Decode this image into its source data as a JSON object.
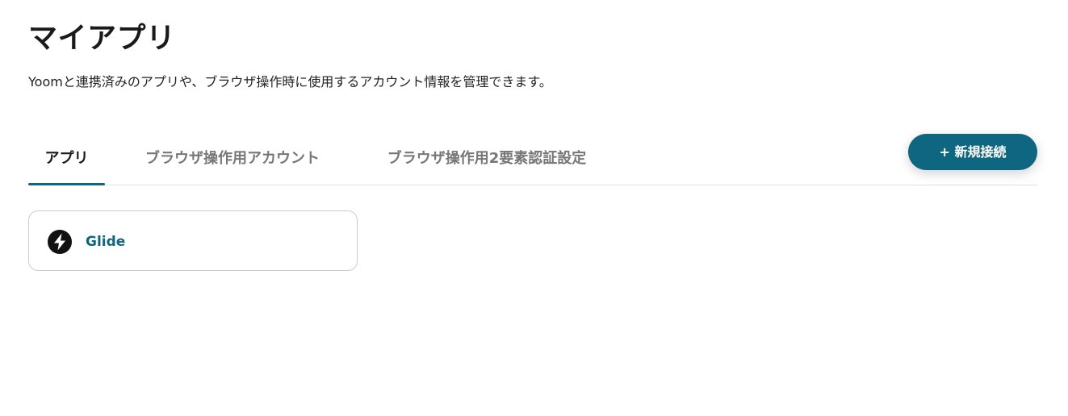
{
  "header": {
    "title": "マイアプリ",
    "description": "Yoomと連携済みのアプリや、ブラウザ操作時に使用するアカウント情報を管理できます。"
  },
  "tabs": [
    {
      "label": "アプリ",
      "active": true
    },
    {
      "label": "ブラウザ操作用アカウント",
      "active": false
    },
    {
      "label": "ブラウザ操作用2要素認証設定",
      "active": false
    }
  ],
  "actions": {
    "new_connection_label": "+ 新規接続"
  },
  "apps": [
    {
      "name": "Glide",
      "icon": "glide-logo-icon"
    }
  ],
  "colors": {
    "accent": "#0f6680",
    "tab_inactive": "#777777",
    "border": "#cccccc"
  }
}
